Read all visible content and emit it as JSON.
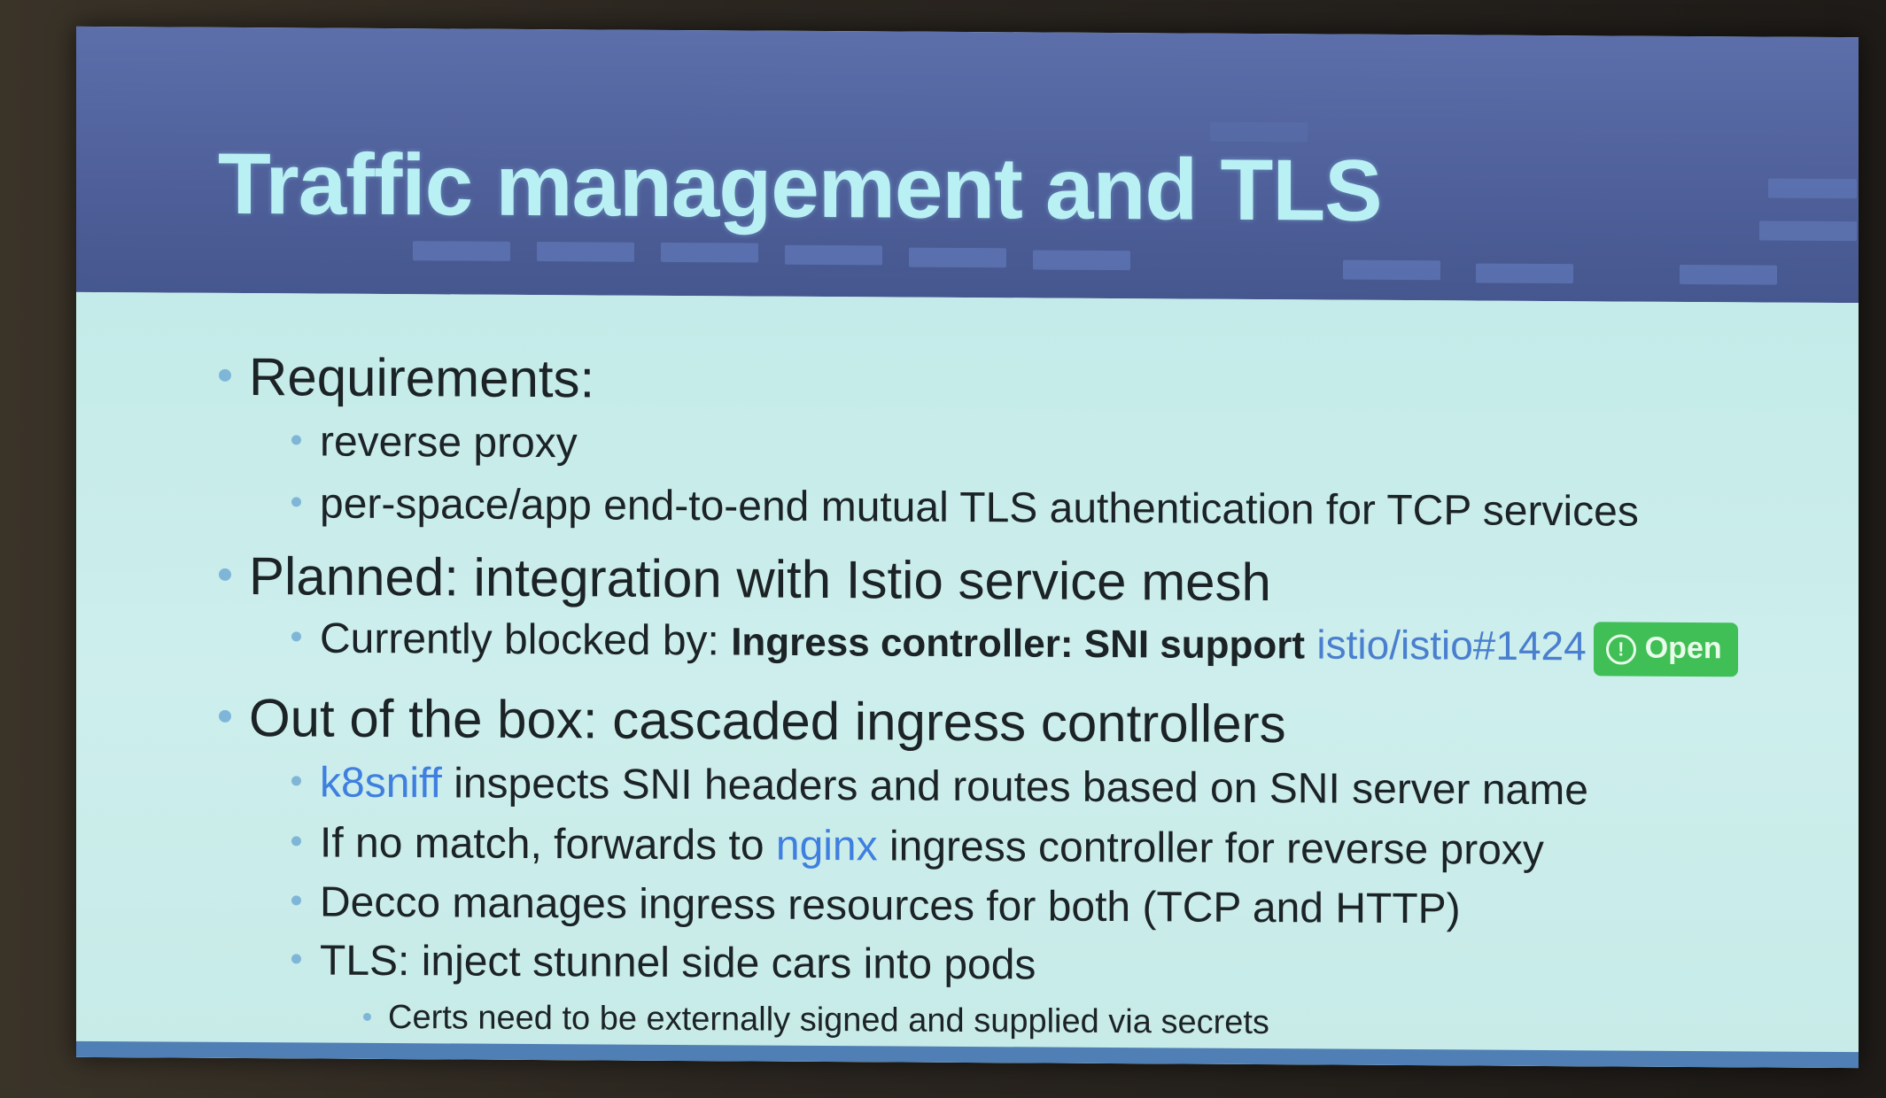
{
  "slide": {
    "title": "Traffic management and TLS",
    "bullets": {
      "b1": "Requirements:",
      "b1_1": "reverse proxy",
      "b1_2": "per-space/app end-to-end mutual TLS authentication for TCP services",
      "b2": "Planned: integration with Istio service mesh",
      "b2_1_prefix": "Currently blocked by: ",
      "b2_1_issue_title": "Ingress controller: SNI support",
      "b2_1_issue_ref": "istio/istio#1424",
      "b2_1_badge": "Open",
      "b2_1_badge_icon": "!",
      "b3": "Out of the box: cascaded ingress controllers",
      "b3_1_link": "k8sniff",
      "b3_1_rest": " inspects SNI headers and routes based on SNI server name",
      "b3_2_prefix": "If no match, forwards to ",
      "b3_2_link": "nginx",
      "b3_2_suffix": " ingress controller for reverse proxy",
      "b3_3": "Decco manages ingress resources for both (TCP and HTTP)",
      "b3_4": "TLS: inject stunnel side cars into pods",
      "b3_4_1": "Certs need to be externally signed and supplied via secrets"
    }
  },
  "colors": {
    "header_bg": "#4e5f99",
    "title_text": "#b9f0f4",
    "body_bg": "#c9ecea",
    "link": "#3f7fe0",
    "badge_green": "#3fbf56"
  },
  "icons": {
    "badge_icon": "issue-open-icon"
  }
}
